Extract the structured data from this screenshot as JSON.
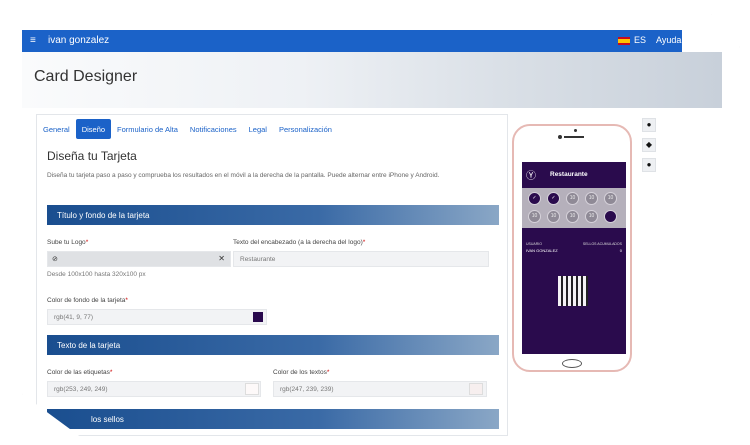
{
  "topbar": {
    "menu_icon": "hamburger-icon",
    "user": "ivan gonzalez",
    "lang": "ES",
    "help": "Ayuda"
  },
  "page": {
    "title": "Card Designer"
  },
  "tabs": [
    {
      "label": "General"
    },
    {
      "label": "Diseño"
    },
    {
      "label": "Formulario de Alta"
    },
    {
      "label": "Notificaciones"
    },
    {
      "label": "Legal"
    },
    {
      "label": "Personalización"
    }
  ],
  "section": {
    "heading": "Diseña tu Tarjeta",
    "description": "Diseña tu tarjeta paso a paso y comprueba los resultados en el móvil a la derecha de la pantalla. Puede alternar entre iPhone y Android."
  },
  "band1": {
    "label": "Título y fondo de la tarjeta"
  },
  "logo_field": {
    "label": "Sube tu Logo",
    "required": "*",
    "hint": "Desde 100x100 hasta 320x100 px"
  },
  "header_text": {
    "label": "Texto del encabezado (a la derecha del logo)",
    "required": "*",
    "value": "Restaurante"
  },
  "bg_color": {
    "label": "Color de fondo de la tarjeta",
    "required": "*",
    "value": "rgb(41, 9, 77)",
    "swatch": "#29094d"
  },
  "band2": {
    "label": "Texto de la tarjeta"
  },
  "label_color": {
    "label": "Color de las etiquetas",
    "required": "*",
    "value": "rgb(253, 249, 249)"
  },
  "text_color": {
    "label": "Color de los textos",
    "required": "*",
    "value": "rgb(247, 239, 239)"
  },
  "band3": {
    "label": "los sellos"
  },
  "preview": {
    "card_title": "Restaurante",
    "stamps": [
      "✓",
      "✓",
      "10",
      "10",
      "10",
      "10",
      "10",
      "10",
      "10",
      ""
    ],
    "info_left_label": "USUARIO",
    "info_right_label": "SELLOS ACUMULADOS",
    "info_left_value": "IVAN GONZALEZ",
    "info_right_value": "0"
  },
  "side_buttons": [
    {
      "icon": "apple-icon"
    },
    {
      "icon": "android-icon"
    },
    {
      "icon": "chat-icon"
    }
  ],
  "colors": {
    "accent": "#1b62c8",
    "card_bg": "#29094d"
  }
}
